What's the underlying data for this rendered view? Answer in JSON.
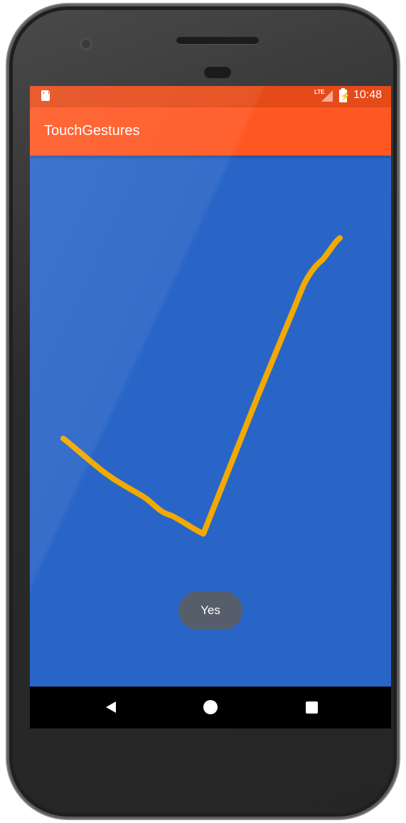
{
  "status_bar": {
    "network": "LTE",
    "time": "10:48",
    "icons": [
      "sd-card-icon",
      "signal-icon",
      "battery-charging-icon"
    ]
  },
  "app_bar": {
    "title": "TouchGestures"
  },
  "toast": {
    "text": "Yes"
  },
  "nav_bar": {
    "buttons": [
      "back-icon",
      "home-icon",
      "recents-icon"
    ]
  },
  "colors": {
    "status_bar": "#e64a19",
    "app_bar": "#ff5722",
    "canvas_background": "#2965c7",
    "gesture_stroke": "#f2a900",
    "toast": "#565d6b"
  }
}
